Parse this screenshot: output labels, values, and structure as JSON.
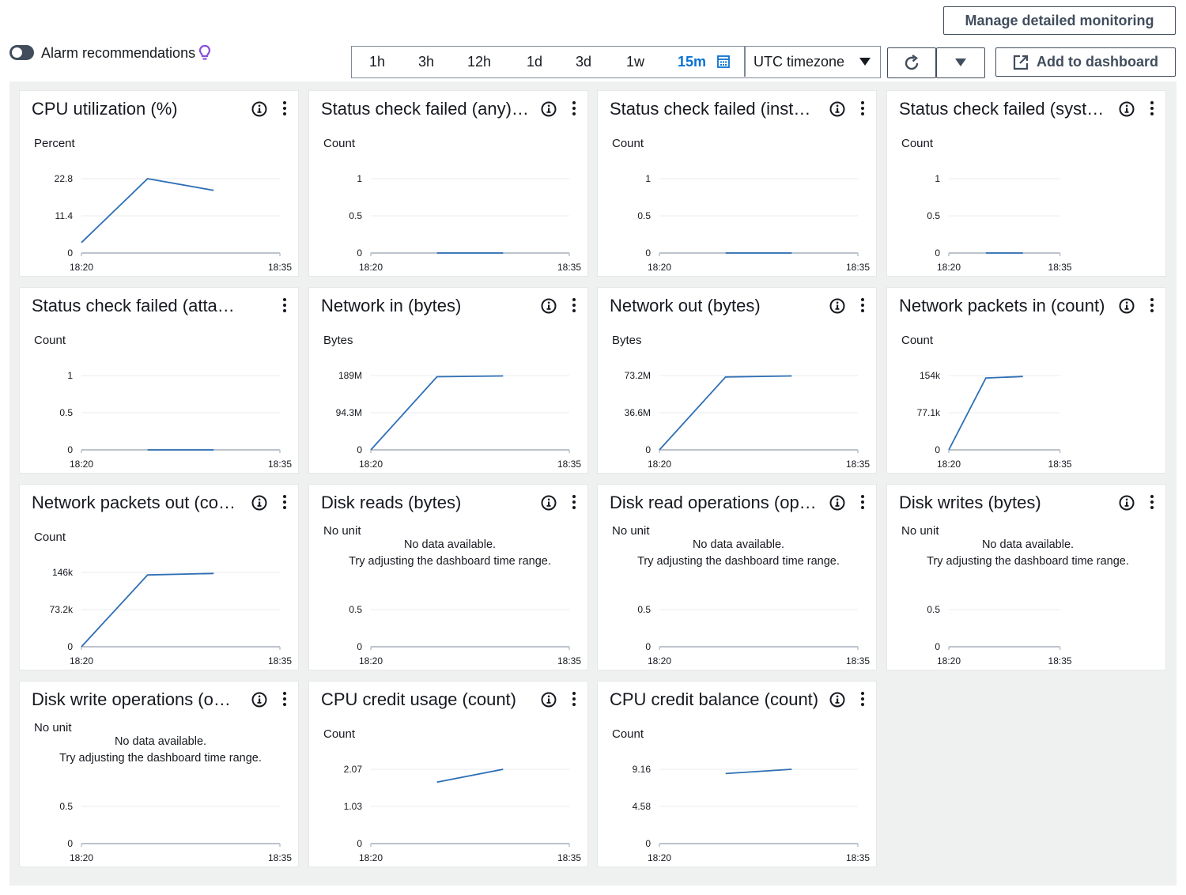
{
  "header": {
    "manage_label": "Manage detailed monitoring",
    "alarm_label": "Alarm recommendations",
    "time_ranges": [
      "1h",
      "3h",
      "12h",
      "1d",
      "3d",
      "1w",
      "15m"
    ],
    "active_range": "15m",
    "timezone": "UTC timezone",
    "add_dashboard_label": "Add to dashboard"
  },
  "colors": {
    "series": "#2e6fb5",
    "baseline": "#bcc3cb",
    "grid": "#e9ebed",
    "accent": "#0972d3",
    "toggle": "#414d5c",
    "bulb": "#8a4fd8"
  },
  "x_axis": {
    "start": "18:20",
    "end": "18:35"
  },
  "no_data": {
    "line1": "No data available.",
    "line2": "Try adjusting the dashboard time range."
  },
  "widgets": [
    {
      "title": "CPU utilization (%)",
      "info": true,
      "unit": "Percent",
      "yticks": [
        "22.8",
        "11.4",
        "0"
      ],
      "ymax": 22.8,
      "nodata": false,
      "baseline_frac": 1.0,
      "chart_data": {
        "type": "line",
        "ylabel": "Percent",
        "x": [
          "18:20",
          "18:25",
          "18:30"
        ],
        "series": [
          {
            "values": [
              3.2,
              22.8,
              19.2
            ]
          }
        ]
      }
    },
    {
      "title": "Status check failed (any)…",
      "info": true,
      "unit": "Count",
      "yticks": [
        "1",
        "0.5",
        "0"
      ],
      "ymax": 1,
      "nodata": false,
      "baseline_frac": 1.0,
      "chart_data": {
        "type": "line",
        "ylabel": "Count",
        "x": [
          "18:25",
          "18:30"
        ],
        "series": [
          {
            "values": [
              0,
              0
            ]
          }
        ]
      }
    },
    {
      "title": "Status check failed (inst…",
      "info": true,
      "unit": "Count",
      "yticks": [
        "1",
        "0.5",
        "0"
      ],
      "ymax": 1,
      "nodata": false,
      "baseline_frac": 1.0,
      "chart_data": {
        "type": "line",
        "ylabel": "Count",
        "x": [
          "18:25",
          "18:30"
        ],
        "series": [
          {
            "values": [
              0,
              0
            ]
          }
        ]
      }
    },
    {
      "title": "Status check failed (syst…",
      "info": true,
      "unit": "Count",
      "yticks": [
        "1",
        "0.5",
        "0"
      ],
      "ymax": 1,
      "nodata": false,
      "baseline_frac": 0.56,
      "chart_data": {
        "type": "line",
        "ylabel": "Count",
        "x": [
          "18:25",
          "18:30"
        ],
        "series": [
          {
            "values": [
              0,
              0
            ]
          }
        ]
      }
    },
    {
      "title": "Status check failed (atta…",
      "info": false,
      "unit": "Count",
      "yticks": [
        "1",
        "0.5",
        "0"
      ],
      "ymax": 1,
      "nodata": false,
      "baseline_frac": 1.0,
      "chart_data": {
        "type": "line",
        "ylabel": "Count",
        "x": [
          "18:25",
          "18:30"
        ],
        "series": [
          {
            "values": [
              0,
              0
            ]
          }
        ]
      }
    },
    {
      "title": "Network in (bytes)",
      "info": true,
      "unit": "Bytes",
      "yticks": [
        "189M",
        "94.3M",
        "0"
      ],
      "ymax": 189,
      "nodata": false,
      "baseline_frac": 1.0,
      "chart_data": {
        "type": "line",
        "ylabel": "Bytes",
        "x": [
          "18:20",
          "18:25",
          "18:30"
        ],
        "series": [
          {
            "values": [
              0,
              186,
              188
            ]
          }
        ]
      }
    },
    {
      "title": "Network out (bytes)",
      "info": true,
      "unit": "Bytes",
      "yticks": [
        "73.2M",
        "36.6M",
        "0"
      ],
      "ymax": 73.2,
      "nodata": false,
      "baseline_frac": 1.0,
      "chart_data": {
        "type": "line",
        "ylabel": "Bytes",
        "x": [
          "18:20",
          "18:25",
          "18:30"
        ],
        "series": [
          {
            "values": [
              0,
              71.8,
              72.8
            ]
          }
        ]
      }
    },
    {
      "title": "Network packets in (count)",
      "info": true,
      "unit": "Count",
      "yticks": [
        "154k",
        "77.1k",
        "0"
      ],
      "ymax": 154,
      "nodata": false,
      "baseline_frac": 0.56,
      "chart_data": {
        "type": "line",
        "ylabel": "Count",
        "x": [
          "18:20",
          "18:25",
          "18:30"
        ],
        "series": [
          {
            "values": [
              0,
              149,
              152
            ]
          }
        ]
      }
    },
    {
      "title": "Network packets out (co…",
      "info": true,
      "unit": "Count",
      "yticks": [
        "146k",
        "73.2k",
        "0"
      ],
      "ymax": 146,
      "nodata": false,
      "baseline_frac": 1.0,
      "chart_data": {
        "type": "line",
        "ylabel": "Count",
        "x": [
          "18:20",
          "18:25",
          "18:30"
        ],
        "series": [
          {
            "values": [
              0,
              141,
              144
            ]
          }
        ]
      }
    },
    {
      "title": "Disk reads (bytes)",
      "info": true,
      "unit": "No unit",
      "yticks": [
        "",
        "0.5",
        "0"
      ],
      "ymax": 1,
      "nodata": true,
      "baseline_frac": 1.0,
      "chart_data": {
        "type": "line",
        "ylabel": "No unit",
        "x": [],
        "series": []
      }
    },
    {
      "title": "Disk read operations (op…",
      "info": true,
      "unit": "No unit",
      "yticks": [
        "",
        "0.5",
        "0"
      ],
      "ymax": 1,
      "nodata": true,
      "baseline_frac": 1.0,
      "chart_data": {
        "type": "line",
        "ylabel": "No unit",
        "x": [],
        "series": []
      }
    },
    {
      "title": "Disk writes (bytes)",
      "info": true,
      "unit": "No unit",
      "yticks": [
        "",
        "0.5",
        "0"
      ],
      "ymax": 1,
      "nodata": true,
      "baseline_frac": 0.56,
      "chart_data": {
        "type": "line",
        "ylabel": "No unit",
        "x": [],
        "series": []
      }
    },
    {
      "title": "Disk write operations (o…",
      "info": true,
      "unit": "No unit",
      "yticks": [
        "",
        "0.5",
        "0"
      ],
      "ymax": 1,
      "nodata": true,
      "baseline_frac": 1.0,
      "chart_data": {
        "type": "line",
        "ylabel": "No unit",
        "x": [],
        "series": []
      }
    },
    {
      "title": "CPU credit usage (count)",
      "info": true,
      "unit": "Count",
      "yticks": [
        "2.07",
        "1.03",
        "0"
      ],
      "ymax": 2.07,
      "nodata": false,
      "baseline_frac": 1.0,
      "chart_data": {
        "type": "line",
        "ylabel": "Count",
        "x": [
          "18:25",
          "18:30"
        ],
        "series": [
          {
            "values": [
              1.71,
              2.07
            ]
          }
        ]
      }
    },
    {
      "title": "CPU credit balance (count)",
      "info": true,
      "unit": "Count",
      "yticks": [
        "9.16",
        "4.58",
        "0"
      ],
      "ymax": 9.16,
      "nodata": false,
      "baseline_frac": 1.0,
      "chart_data": {
        "type": "line",
        "ylabel": "Count",
        "x": [
          "18:25",
          "18:30"
        ],
        "series": [
          {
            "values": [
              8.63,
              9.16
            ]
          }
        ]
      }
    }
  ]
}
